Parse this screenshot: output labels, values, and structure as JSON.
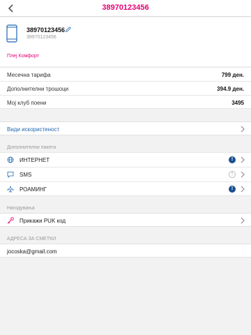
{
  "header": {
    "title": "38970123456",
    "accent": "#e20074"
  },
  "account": {
    "number": "38970123456",
    "sub_number": "38970123456",
    "plan": "Плеј Комфорт"
  },
  "summary": [
    {
      "label": "Месечна тарифа",
      "value": "799 ден."
    },
    {
      "label": "Дополнителни трошоци",
      "value": "394.9 ден."
    },
    {
      "label": "Мој клуб поени",
      "value": "3495"
    }
  ],
  "usage_link": "Види искористеност",
  "packages": {
    "heading": "Дополнителни пакети",
    "items": [
      {
        "label": "ИНТЕРНЕТ",
        "icon": "globe-icon",
        "badge": "!",
        "badge_state": "active"
      },
      {
        "label": "SMS",
        "icon": "chat-icon",
        "badge": "!",
        "badge_state": "inactive"
      },
      {
        "label": "РОАМИНГ",
        "icon": "plane-icon",
        "badge": "!",
        "badge_state": "active"
      }
    ]
  },
  "settings": {
    "heading": "Нагодувања",
    "puk_label": "Прикажи PUK код"
  },
  "billing": {
    "heading": "АДРЕСА ЗА СМЕТКИ",
    "email": "jocoska@gmail.com"
  }
}
